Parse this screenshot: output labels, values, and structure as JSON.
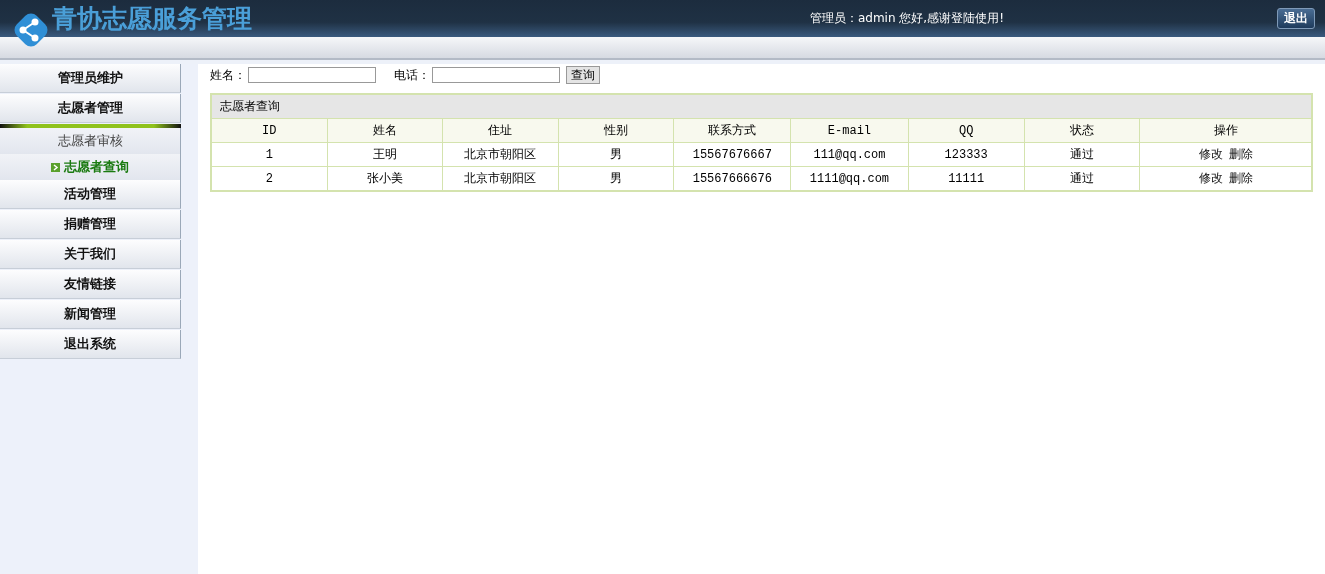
{
  "header": {
    "title": "青协志愿服务管理",
    "greeting": "管理员：admin 您好,感谢登陆使用!",
    "logout_button": "退出"
  },
  "sidebar": {
    "items": [
      {
        "label": "管理员维护"
      },
      {
        "label": "志愿者管理",
        "children": [
          {
            "label": "志愿者审核",
            "selected": false
          },
          {
            "label": "志愿者查询",
            "selected": true
          }
        ]
      },
      {
        "label": "活动管理"
      },
      {
        "label": "捐赠管理"
      },
      {
        "label": "关于我们"
      },
      {
        "label": "友情链接"
      },
      {
        "label": "新闻管理"
      },
      {
        "label": "退出系统"
      }
    ]
  },
  "search": {
    "fields": [
      {
        "label": "姓名："
      },
      {
        "label": "电话："
      }
    ],
    "button": "查询"
  },
  "table": {
    "title": "志愿者查询",
    "columns": [
      "ID",
      "姓名",
      "住址",
      "性别",
      "联系方式",
      "E-mail",
      "QQ",
      "状态",
      "操作"
    ],
    "rows": [
      {
        "cells": [
          "1",
          "王明",
          "北京市朝阳区",
          "男",
          "15567676667",
          "111@qq.com",
          "123333",
          "通过"
        ],
        "actions": [
          "修改",
          "删除"
        ]
      },
      {
        "cells": [
          "2",
          "张小美",
          "北京市朝阳区",
          "男",
          "15567666676",
          "1111@qq.com",
          "11111",
          "通过"
        ],
        "actions": [
          "修改",
          "删除"
        ]
      }
    ]
  }
}
